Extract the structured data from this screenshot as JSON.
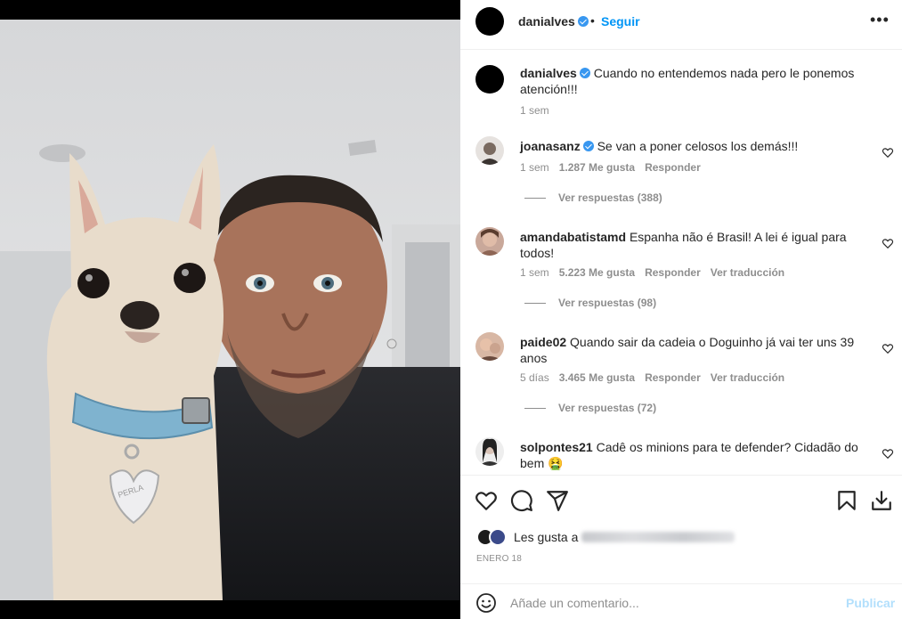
{
  "post": {
    "author": "danialves",
    "follow_label": "Seguir",
    "separator": "•",
    "more_label": "•••",
    "caption": "Cuando no entendemos nada pero le ponemos atención!!!",
    "caption_time": "1 sem",
    "photo_tag_text": "PERLA"
  },
  "comments": [
    {
      "user": "joanasanz",
      "verified": true,
      "text": "Se van a poner celosos los demás!!!",
      "time": "1 sem",
      "likes": "1.287 Me gusta",
      "reply": "Responder",
      "translate": "",
      "view_replies": "Ver respuestas (388)"
    },
    {
      "user": "amandabatistamd",
      "verified": false,
      "text": "Espanha não é Brasil! A lei é igual para todos!",
      "time": "1 sem",
      "likes": "5.223 Me gusta",
      "reply": "Responder",
      "translate": "Ver traducción",
      "view_replies": "Ver respuestas (98)"
    },
    {
      "user": "paide02",
      "verified": false,
      "text": "Quando sair da cadeia o Doguinho já vai ter uns 39 anos",
      "time": "5 días",
      "likes": "3.465 Me gusta",
      "reply": "Responder",
      "translate": "Ver traducción",
      "view_replies": "Ver respuestas (72)"
    },
    {
      "user": "solpontes21",
      "verified": false,
      "text": "Cadê os minions para te defender? Cidadão do bem 🤮"
    }
  ],
  "likes_summary": {
    "prefix": "Les gusta a"
  },
  "post_date": "ENERO 18",
  "add_comment": {
    "placeholder": "Añade un comentario...",
    "publish_label": "Publicar"
  },
  "colors": {
    "accent": "#0095f6",
    "verified": "#3897f0",
    "muted": "#8e8e8e",
    "publish_disabled": "#b2dffc"
  },
  "icons": [
    "heart-icon",
    "comment-icon",
    "share-icon",
    "bookmark-icon",
    "download-icon",
    "emoji-icon",
    "more-icon",
    "verified-icon"
  ]
}
